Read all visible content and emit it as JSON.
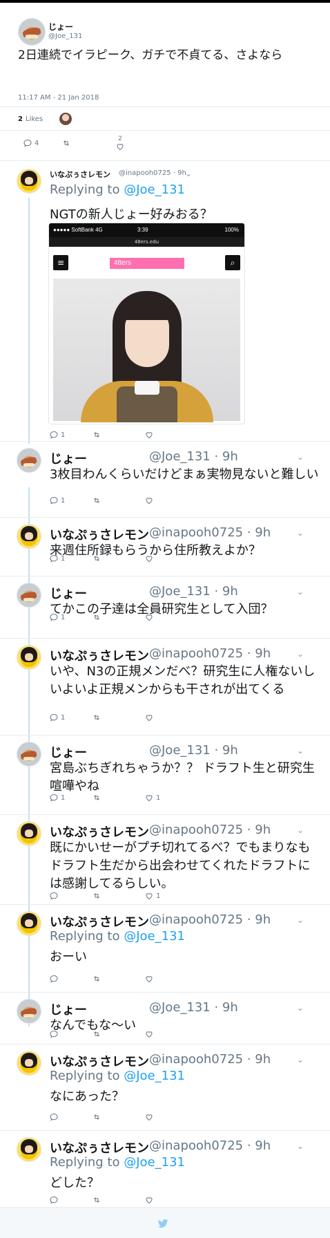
{
  "main": {
    "name": "じょー",
    "handle": "@Joe_131",
    "text": "2日連続でイラピーク、ガチで不貞てる、さよなら",
    "timestamp": "11:17 AM - 21 Jan 2018",
    "likes_count": "2",
    "likes_label": "Likes",
    "reply_count": "4",
    "retweet_count": "",
    "like_count": "2"
  },
  "colors": {
    "link": "#1da1f2",
    "muted": "#657786",
    "thread_line": "#c4dff3"
  },
  "replies": [
    {
      "name": "いなぷぅさレモン",
      "handle": "@inapooh0725 · 9h",
      "replying_prefix": "Replying to",
      "replying_to": "@Joe_131",
      "text": "NGTの新人じょー好みおる？",
      "reply_count": "1",
      "retweet_count": "",
      "like_count": "",
      "photo": {
        "status_carrier": "●●●●● SoftBank  4G",
        "status_time": "3:39",
        "status_battery": "100%",
        "url": "48ers.edu",
        "logo": "48ers"
      }
    },
    {
      "name": "じょー",
      "handle": "@Joe_131 · 9h",
      "text": "3枚目わんくらいだけどまぁ実物見ないと難しい",
      "reply_count": "1",
      "retweet_count": "",
      "like_count": ""
    },
    {
      "name": "いなぷぅさレモン",
      "handle": "@inapooh0725 · 9h",
      "text": "来週住所録もらうから住所教えよか？",
      "reply_count": "1",
      "retweet_count": "",
      "like_count": ""
    },
    {
      "name": "じょー",
      "handle": "@Joe_131 · 9h",
      "text": "てかこの子達は全員研究生として入団？",
      "reply_count": "1",
      "retweet_count": "",
      "like_count": ""
    },
    {
      "name": "いなぷぅさレモン",
      "handle": "@inapooh0725 · 9h",
      "text": "いや、N3の正規メンだべ？研究生に人権ないしいよいよ正規メンからも干されが出てくる",
      "reply_count": "1",
      "retweet_count": "",
      "like_count": ""
    },
    {
      "name": "じょー",
      "handle": "@Joe_131 · 9h",
      "text": "宮島ぶちぎれちゃうか？？ ドラフト生と研究生喧嘩やね",
      "reply_count": "1",
      "retweet_count": "",
      "like_count": "1"
    },
    {
      "name": "いなぷぅさレモン",
      "handle": "@inapooh0725 · 9h",
      "text": "既にかいせーがプチ切れてるべ？でもまりなもドラフト生だから出会わせてくれたドラフトには感謝してるらしい。",
      "reply_count": "",
      "retweet_count": "",
      "like_count": "1"
    },
    {
      "name": "いなぷぅさレモン",
      "handle": "@inapooh0725 · 9h",
      "replying_prefix": "Replying to",
      "replying_to": "@Joe_131",
      "text": "おーい",
      "reply_count": "",
      "retweet_count": "",
      "like_count": ""
    },
    {
      "name": "じょー",
      "handle": "@Joe_131 · 9h",
      "text": "なんでもな〜い",
      "reply_count": "",
      "retweet_count": "",
      "like_count": ""
    },
    {
      "name": "いなぷぅさレモン",
      "handle": "@inapooh0725 · 9h",
      "replying_prefix": "Replying to",
      "replying_to": "@Joe_131",
      "text": "なにあった？",
      "reply_count": "",
      "retweet_count": "",
      "like_count": ""
    },
    {
      "name": "いなぷぅさレモン",
      "handle": "@inapooh0725 · 9h",
      "replying_prefix": "Replying to",
      "replying_to": "@Joe_131",
      "text": "どした？",
      "reply_count": "",
      "retweet_count": "",
      "like_count": ""
    }
  ]
}
